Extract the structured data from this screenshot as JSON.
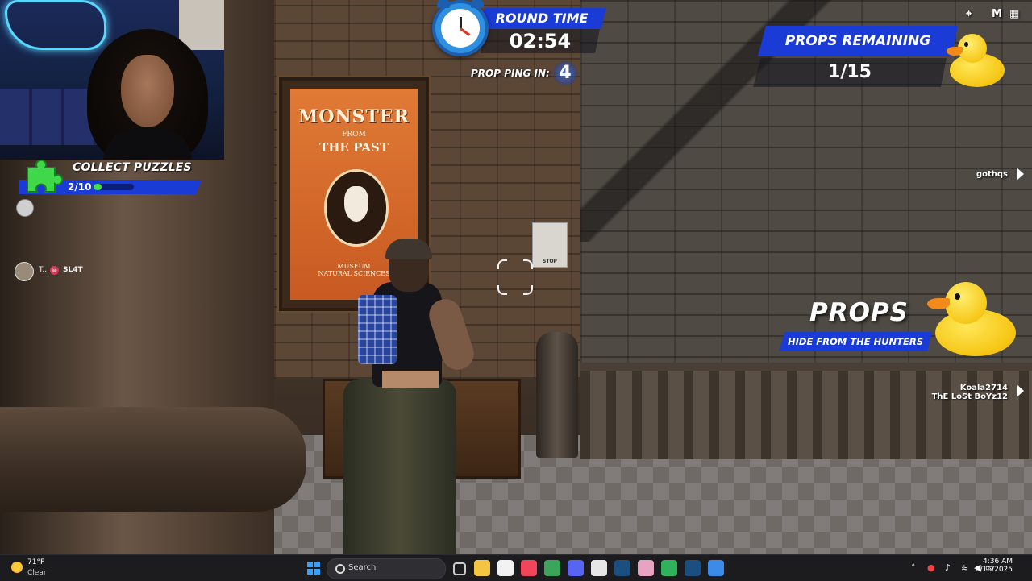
{
  "poster": {
    "title": "MONSTER",
    "from": "FROM",
    "subtitle": "THE PAST",
    "museum": "MUSEUM",
    "museum_sub": "NATURAL SCIENCES"
  },
  "sign": {
    "text": "STOP"
  },
  "hud": {
    "round": {
      "label": "ROUND TIME",
      "time": "02:54"
    },
    "ping": {
      "label": "PROP PING IN:",
      "value": "4"
    },
    "remaining": {
      "label": "PROPS REMAINING",
      "count": "1/15"
    },
    "puzzles": {
      "title": "COLLECT PUZZLES",
      "count": "2/10",
      "progress": 0.2
    },
    "props_banner": {
      "title": "PROPS",
      "subtitle": "HIDE FROM THE HUNTERS"
    },
    "player_tag": {
      "name_left": "T...",
      "name_right": "SL4T"
    },
    "nametags": [
      {
        "name": "gothqs"
      },
      {
        "name": "Koala2714"
      },
      {
        "name": "ThE LoSt BoYz12"
      }
    ],
    "top_right_key": "M"
  },
  "colors": {
    "accent_blue": "#1a3bd6",
    "progress_green": "#44e04a",
    "duck_yellow": "#f6c512"
  },
  "taskbar": {
    "weather": {
      "temp": "71°F",
      "condition": "Clear"
    },
    "search_placeholder": "Search",
    "apps": [
      {
        "name": "file-explorer-icon",
        "color": "#f4c542"
      },
      {
        "name": "store-icon",
        "color": "#f2f2f2"
      },
      {
        "name": "music-icon",
        "color": "#f0455a"
      },
      {
        "name": "chrome-icon",
        "color": "#3ba55c"
      },
      {
        "name": "discord-icon",
        "color": "#5865f2"
      },
      {
        "name": "clock-app-icon",
        "color": "#e6e6e6"
      },
      {
        "name": "steam-icon",
        "color": "#1b4f80"
      },
      {
        "name": "app-pink-icon",
        "color": "#e6a3c2"
      },
      {
        "name": "xbox-icon",
        "color": "#2fb25c"
      },
      {
        "name": "steam-2-icon",
        "color": "#1b4f80"
      },
      {
        "name": "fortnite-icon",
        "color": "#3d8be8"
      }
    ],
    "time": "4:36 AM",
    "date": "8/16/2025"
  }
}
